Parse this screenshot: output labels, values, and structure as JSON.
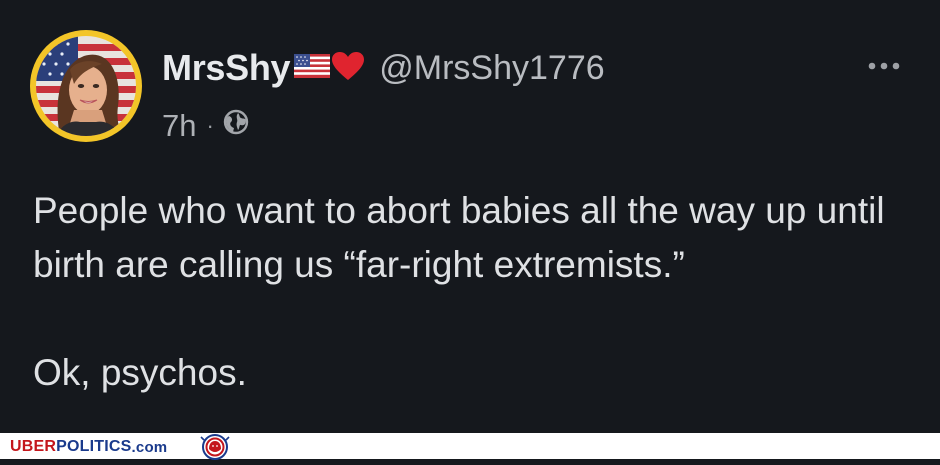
{
  "tweet": {
    "display_name": "MrsShy",
    "handle": "@MrsShy1776",
    "time": "7h",
    "separator": "·",
    "paragraphs": [
      "People who want to abort babies all the way up until birth are calling us “far-right extremists.”",
      "Ok, psychos."
    ],
    "icons": [
      "us-flag-icon",
      "red-heart-icon",
      "globe-icon",
      "more-options-icon"
    ]
  },
  "watermark": {
    "part1": "UBER",
    "part2": "POLITICS",
    "part3": ".com",
    "logo": "lion-seal-logo"
  },
  "colors": {
    "background": "#15181d",
    "text_primary": "#dfe1e4",
    "text_secondary": "#aeb1b6",
    "avatar_ring": "#f3c528",
    "heart": "#e0242f",
    "watermark_red": "#c4161c",
    "watermark_blue": "#1a3a8c"
  }
}
